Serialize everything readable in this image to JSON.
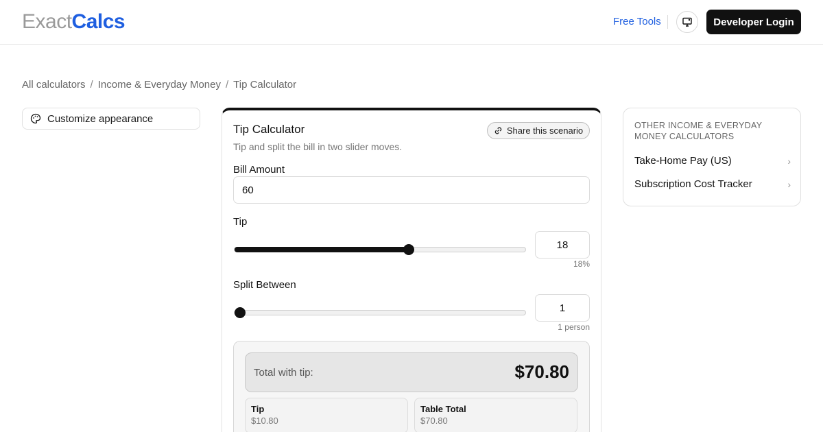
{
  "header": {
    "logo_light": "Exact",
    "logo_bold": "Calcs",
    "free_tools": "Free Tools",
    "developer_login": "Developer Login"
  },
  "breadcrumb": {
    "items": [
      "All calculators",
      "Income & Everyday Money",
      "Tip Calculator"
    ],
    "separator": "/"
  },
  "customize": {
    "label": "Customize appearance"
  },
  "calculator": {
    "title": "Tip Calculator",
    "subtitle": "Tip and split the bill in two slider moves.",
    "share_label": "Share this scenario",
    "bill": {
      "label": "Bill Amount",
      "value": "60"
    },
    "tip": {
      "label": "Tip",
      "value": "18",
      "hint": "18%",
      "level": 0.6
    },
    "split": {
      "label": "Split Between",
      "value": "1",
      "hint": "1 person",
      "level": 0
    },
    "results": {
      "total_label": "Total with tip:",
      "total_value": "$70.80",
      "tip_title": "Tip",
      "tip_value": "$10.80",
      "table_title": "Table Total",
      "table_value": "$70.80"
    }
  },
  "side": {
    "title": "OTHER INCOME & EVERYDAY MONEY CALCULATORS",
    "items": [
      "Take-Home Pay (US)",
      "Subscription Cost Tracker"
    ]
  },
  "colors": {
    "accent": "#1f5fe0",
    "dark": "#111111"
  }
}
